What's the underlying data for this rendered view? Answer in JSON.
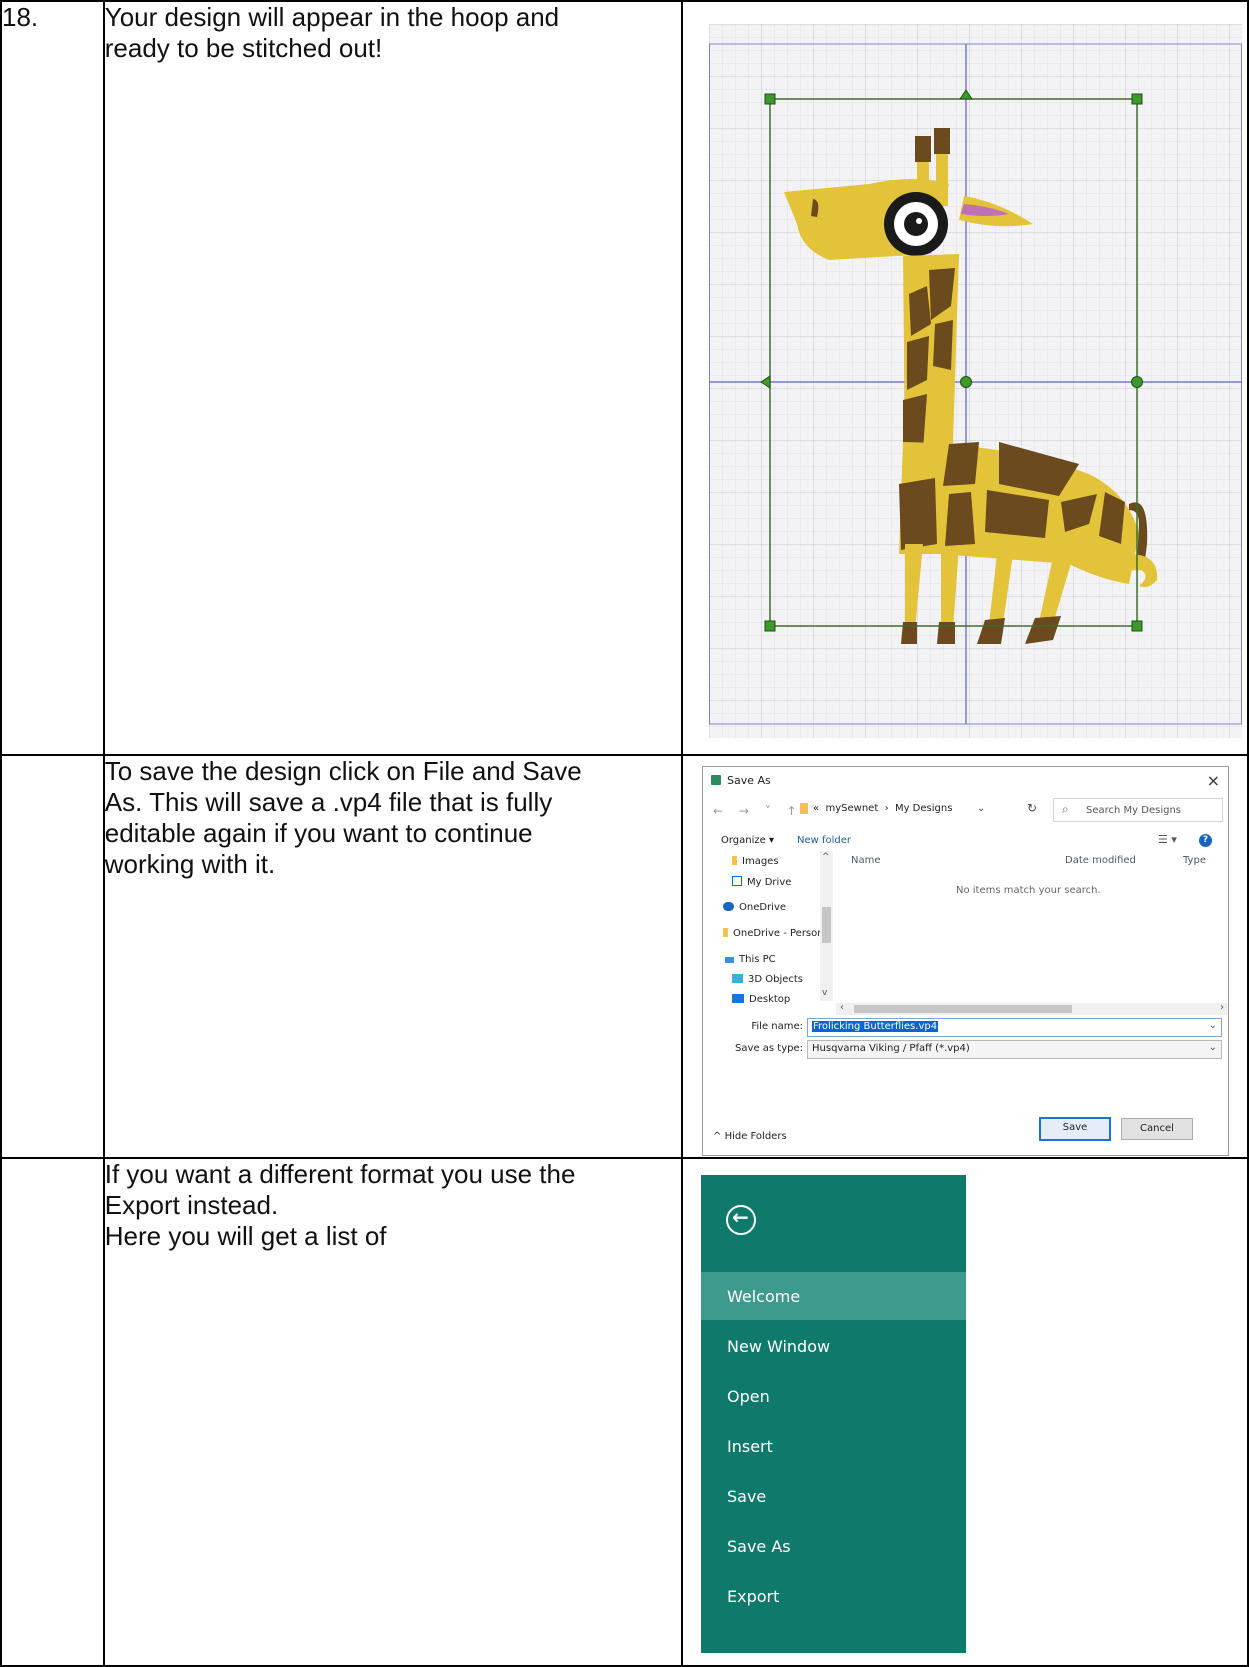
{
  "rows": [
    {
      "number": "18.",
      "text": [
        "Your design will appear in the hoop and",
        "ready to be stitched out!"
      ]
    },
    {
      "number": "",
      "text": [
        "To save the design click on File and Save",
        "As. This will save a .vp4 file that is fully",
        "editable again if you want to continue",
        "working with it."
      ]
    },
    {
      "number": "",
      "text": [
        "If you want a different format you use the",
        "Export instead.",
        "Here you will get a list of"
      ]
    }
  ],
  "hoop_image": {
    "colors": {
      "body": "#e3c33a",
      "patch": "#6b4a1e",
      "frame": "#3c6e2b",
      "grid": "#cfd3dc",
      "hoop_line": "#5b63b8",
      "ear": "#c070b8"
    }
  },
  "save_dialog": {
    "title": "Save As",
    "close": "×",
    "nav_arrows": "← → ˅ ↑",
    "address": {
      "prefix": "«",
      "part1": "mySewnet",
      "sep": "›",
      "part2": "My Designs"
    },
    "search_placeholder": "Search My Designs",
    "toolbar": {
      "organize": "Organize ▾",
      "new_folder": "New folder",
      "help": "?"
    },
    "tree": [
      {
        "label": "Images",
        "icon": "folder-icon"
      },
      {
        "label": "My Drive",
        "icon": "drive-icon"
      },
      {
        "label": "OneDrive",
        "icon": "cloud-icon"
      },
      {
        "label": "OneDrive - Person",
        "icon": "folder-icon"
      },
      {
        "label": "This PC",
        "icon": "pc-icon"
      },
      {
        "label": "3D Objects",
        "icon": "cube-icon"
      },
      {
        "label": "Desktop",
        "icon": "desktop-icon"
      }
    ],
    "columns": {
      "name": "Name",
      "date": "Date modified",
      "type": "Type"
    },
    "empty_message": "No items match your search.",
    "file_name_label": "File name:",
    "file_name_value": "Frolicking Butterflies.vp4",
    "save_type_label": "Save as type:",
    "save_type_value": "Husqvarna Viking / Pfaff (*.vp4)",
    "hide_folders": "Hide Folders",
    "save_button": "Save",
    "cancel_button": "Cancel"
  },
  "file_menu": {
    "back_icon": "back-arrow-icon",
    "items": [
      "Welcome",
      "New Window",
      "Open",
      "Insert",
      "Save",
      "Save As",
      "Export"
    ],
    "active_item": "Welcome",
    "colors": {
      "bg": "#0f7a6b",
      "active": "#3e9a8c"
    }
  }
}
